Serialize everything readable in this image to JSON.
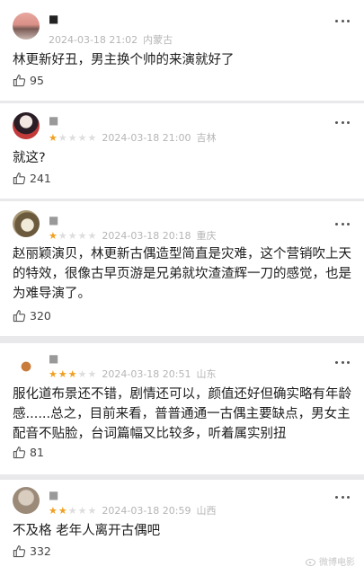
{
  "comments": [
    {
      "user": "■",
      "stars": null,
      "date": "2024-03-18 21:02",
      "region": "内蒙古",
      "text": "林更新好丑，男主换个帅的来演就好了",
      "likes": "95"
    },
    {
      "user": "■",
      "stars": 1,
      "date": "2024-03-18 21:00",
      "region": "吉林",
      "text": "就这?",
      "likes": "241"
    },
    {
      "user": "■",
      "stars": 1,
      "date": "2024-03-18 20:18",
      "region": "重庆",
      "text": "赵丽颖演贝，林更新古偶造型简直是灾难，这个营销吹上天的特效，很像古早页游是兄弟就坎渣渣辉一刀的感觉，也是为难导演了。",
      "likes": "320"
    },
    {
      "user": "■",
      "stars": 3,
      "date": "2024-03-18 20:51",
      "region": "山东",
      "text": "服化道布景还不错，剧情还可以，颜值还好但确实略有年龄感......总之，目前来看，普普通通一古偶主要缺点，男女主配音不贴脸，台词篇幅又比较多，听着属实别扭",
      "likes": "81"
    },
    {
      "user": "■",
      "stars": 2,
      "date": "2024-03-18 20:59",
      "region": "山西",
      "text": "不及格 老年人离开古偶吧",
      "likes": "332"
    }
  ],
  "colors": {
    "star_on": "#f0a020",
    "star_off": "#dddddd",
    "meta": "#b5b5b5",
    "background": "#e9e9ec"
  },
  "watermark": "微博电影"
}
